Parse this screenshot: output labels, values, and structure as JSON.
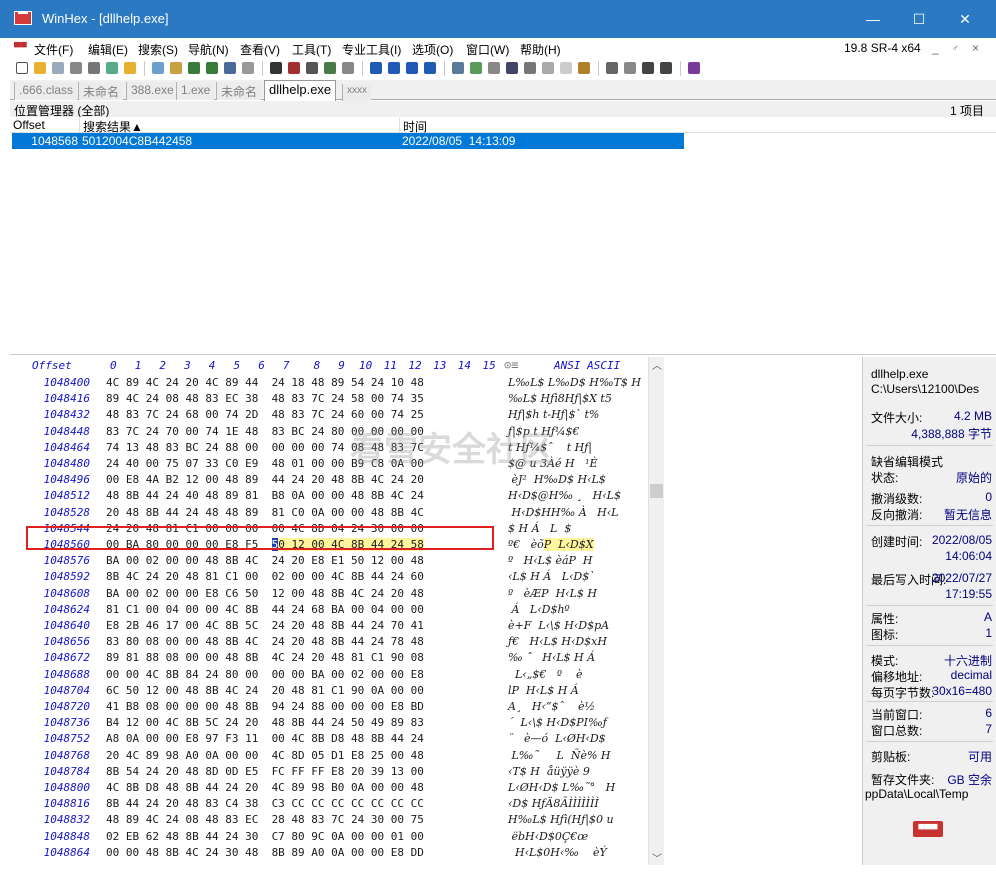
{
  "window": {
    "title": "WinHex - [dllhelp.exe]",
    "minimize": "—",
    "maximize": "☐",
    "close": "✕"
  },
  "menu": {
    "items": [
      "文件(F)",
      "编辑(E)",
      "搜索(S)",
      "导航(N)",
      "查看(V)",
      "工具(T)",
      "专业工具(I)",
      "选项(O)",
      "窗口(W)",
      "帮助(H)"
    ],
    "version": "19.8 SR-4 x64",
    "mdi_controls": [
      "_",
      "♂",
      "×"
    ]
  },
  "tabs": [
    ".666.class",
    "未命名",
    "388.exe",
    "1.exe",
    "未命名",
    "dllhelp.exe",
    "xxxx"
  ],
  "position_manager": {
    "title": "位置管理器 (全部)",
    "count": "1 项目",
    "columns": {
      "offset": "Offset",
      "search": "搜索结果▲",
      "time": "时间"
    },
    "row": {
      "offset": "1048568",
      "search": "5012004C8B442458",
      "time": "2022/08/05  14:13:09"
    }
  },
  "hex": {
    "header_offset": "Offset",
    "header_cols": [
      "0",
      "1",
      "2",
      "3",
      "4",
      "5",
      "6",
      "7",
      "8",
      "9",
      "10",
      "11",
      "12",
      "13",
      "14",
      "15"
    ],
    "header_ascii": "ANSI ASCII",
    "rows": [
      {
        "off": "1048400",
        "hex": "4C 89 4C 24 20 4C 89 44  24 18 48 89 54 24 10 48",
        "asc": "L‰L$ L‰D$ H‰T$ H"
      },
      {
        "off": "1048416",
        "hex": "89 4C 24 08 48 83 EC 38  48 83 7C 24 58 00 74 35",
        "asc": "‰L$ Hƒì8Hƒ|$X t5"
      },
      {
        "off": "1048432",
        "hex": "48 83 7C 24 68 00 74 2D  48 83 7C 24 60 00 74 25",
        "asc": "Hƒ|$h t-Hƒ|$` t%"
      },
      {
        "off": "1048448",
        "hex": "83 7C 24 70 00 74 1E 48  83 BC 24 80 00 00 00 00",
        "asc": "ƒ|$p t Hƒ¼$€"
      },
      {
        "off": "1048464",
        "hex": "74 13 48 83 BC 24 88 00  00 00 00 74 08 48 83 7C",
        "asc": "t Hƒ¼$ˆ    t Hƒ|"
      },
      {
        "off": "1048480",
        "hex": "24 40 00 75 07 33 C0 E9  48 01 00 00 B9 C8 0A 00",
        "asc": "$@ u 3Àé H   ¹È"
      },
      {
        "off": "1048496",
        "hex": "00 E8 4A B2 12 00 48 89  44 24 20 48 8B 4C 24 20",
        "asc": " èJ²  H‰D$ H‹L$"
      },
      {
        "off": "1048512",
        "hex": "48 8B 44 24 40 48 89 81  B8 0A 00 00 48 8B 4C 24",
        "asc": "H‹D$@H‰ ¸   H‹L$"
      },
      {
        "off": "1048528",
        "hex": "20 48 8B 44 24 48 48 89  81 C0 0A 00 00 48 8B 4C",
        "asc": " H‹D$HH‰ À   H‹L"
      },
      {
        "off": "1048544",
        "hex": "24 20 48 81 C1 00 00 00  00 4C 8D 04 24 30 00 00",
        "asc": "$ H Á   L  $"
      },
      {
        "off": "1048560",
        "hex": "00 BA 80 00 00 00 E8 F5  50 12 00 4C 8B 44 24 58",
        "asc": "º€   èõP  L‹D$X"
      },
      {
        "off": "1048576",
        "hex": "BA 00 02 00 00 48 8B 4C  24 20 E8 E1 50 12 00 48",
        "asc": "º   H‹L$ èáP  H"
      },
      {
        "off": "1048592",
        "hex": "8B 4C 24 20 48 81 C1 00  02 00 00 4C 8B 44 24 60",
        "asc": "‹L$ H Á   L‹D$`"
      },
      {
        "off": "1048608",
        "hex": "BA 00 02 00 00 E8 C6 50  12 00 48 8B 4C 24 20 48",
        "asc": "º   èÆP  H‹L$ H"
      },
      {
        "off": "1048624",
        "hex": "81 C1 00 04 00 00 4C 8B  44 24 68 BA 00 04 00 00",
        "asc": " Á   L‹D$hº"
      },
      {
        "off": "1048640",
        "hex": "E8 2B 46 17 00 4C 8B 5C  24 20 48 8B 44 24 70 41",
        "asc": "è+F  L‹\\$ H‹D$pA"
      },
      {
        "off": "1048656",
        "hex": "83 80 08 00 00 48 8B 4C  24 20 48 8B 44 24 78 48",
        "asc": "ƒ€   H‹L$ H‹D$xH"
      },
      {
        "off": "1048672",
        "hex": "89 81 88 08 00 00 48 8B  4C 24 20 48 81 C1 90 08",
        "asc": "‰ ˆ   H‹L$ H Á"
      },
      {
        "off": "1048688",
        "hex": "00 00 4C 8B 84 24 80 00  00 00 BA 00 02 00 00 E8",
        "asc": "  L‹„$€   º    è"
      },
      {
        "off": "1048704",
        "hex": "6C 50 12 00 48 8B 4C 24  20 48 81 C1 90 0A 00 00",
        "asc": "lP  H‹L$ H Á"
      },
      {
        "off": "1048720",
        "hex": "41 B8 08 00 00 00 48 8B  94 24 88 00 00 00 E8 BD",
        "asc": "A¸   H‹”$ˆ    è½"
      },
      {
        "off": "1048736",
        "hex": "B4 12 00 4C 8B 5C 24 20  48 8B 44 24 50 49 89 83",
        "asc": "´  L‹\\$ H‹D$PI‰ƒ"
      },
      {
        "off": "1048752",
        "hex": "A8 0A 00 00 E8 97 F3 11  00 4C 8B D8 48 8B 44 24",
        "asc": "¨   è—ó  L‹ØH‹D$"
      },
      {
        "off": "1048768",
        "hex": "20 4C 89 98 A0 0A 00 00  4C 8D 05 D1 E8 25 00 48",
        "asc": " L‰˜     L  Ñè% H"
      },
      {
        "off": "1048784",
        "hex": "8B 54 24 20 48 8D 0D E5  FC FF FF E8 20 39 13 00",
        "asc": "‹T$ H  åüÿÿè 9"
      },
      {
        "off": "1048800",
        "hex": "4C 8B D8 48 8B 44 24 20  4C 89 98 B0 0A 00 00 48",
        "asc": "L‹ØH‹D$ L‰˜°   H"
      },
      {
        "off": "1048816",
        "hex": "8B 44 24 20 48 83 C4 38  C3 CC CC CC CC CC CC CC",
        "asc": "‹D$ HƒÄ8ÃÌÌÌÌÌÌÌ"
      },
      {
        "off": "1048832",
        "hex": "48 89 4C 24 08 48 83 EC  28 48 83 7C 24 30 00 75",
        "asc": "H‰L$ Hƒì(Hƒ|$0 u"
      },
      {
        "off": "1048848",
        "hex": "02 EB 62 48 8B 44 24 30  C7 80 9C 0A 00 00 01 00",
        "asc": " ëbH‹D$0Ç€œ"
      },
      {
        "off": "1048864",
        "hex": "00 00 48 8B 4C 24 30 48  8B 89 A0 0A 00 00 E8 DD",
        "asc": "  H‹L$0H‹‰    èÝ"
      }
    ]
  },
  "watermark": "看雪安全社区",
  "side": {
    "filename": "dllhelp.exe",
    "path": "C:\\Users\\12100\\Des",
    "size_label": "文件大小:",
    "size_value": "4.2 MB",
    "size_bytes": "4,388,888 字节",
    "mode_title": "缺省编辑模式",
    "state_label": "状态:",
    "state_value": "原始的",
    "undo_label": "撤消级数:",
    "undo_value": "0",
    "redo_label": "反向撤消:",
    "redo_value": "暂无信息",
    "created_label": "创建时间:",
    "created_date": "2022/08/05",
    "created_time": "14:06:04",
    "modified_label": "最后写入时间:",
    "modified_date": "2022/07/27",
    "modified_time": "17:19:55",
    "attr_label": "属性:",
    "attr_value": "A",
    "icons_label": "图标:",
    "icons_value": "1",
    "mode_label": "模式:",
    "mode_value": "十六进制",
    "offset_label": "偏移地址:",
    "offset_value": "decimal",
    "bpp_label": "每页字节数:",
    "bpp_value": "30x16=480",
    "curwin_label": "当前窗口:",
    "curwin_value": "6",
    "totwin_label": "窗口总数:",
    "totwin_value": "7",
    "clip_label": "剪贴板:",
    "clip_value": "可用",
    "temp_label": "暂存文件夹:",
    "temp_value": "GB 空余",
    "temp_path": "ppData\\Local\\Temp"
  },
  "colors": {
    "titlebar": "#2b79c2",
    "selection": "#0078d7",
    "offset_text": "#1414c8",
    "highlight": "#fff59d",
    "cursor": "#1b3fae",
    "redbox": "#e02020"
  }
}
